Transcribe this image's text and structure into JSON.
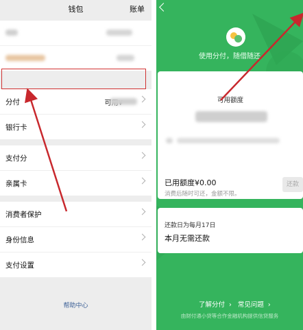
{
  "left": {
    "header": {
      "title": "钱包",
      "bill_label": "账单"
    },
    "pay_row": {
      "label": "分付",
      "available_prefix": "可用¥"
    },
    "menu": [
      {
        "label": "银行卡"
      },
      {
        "label": "支付分"
      },
      {
        "label": "亲属卡"
      },
      {
        "label": "消费者保护"
      },
      {
        "label": "身份信息"
      },
      {
        "label": "支付设置"
      }
    ],
    "help_label": "帮助中心"
  },
  "right": {
    "slogan": "使用分付，随借随还",
    "available_title": "可用额度",
    "used_amount": "已用额度¥0.00",
    "note": "消费后随时可还，金额不限。",
    "repay_button": "还款",
    "repay_day": "还款日为每月17日",
    "status": "本月无需还款",
    "link_learn": "了解分付",
    "link_faq": "常见问题",
    "footer": "由财付通小贷等合作金融机构提供信贷服务"
  },
  "colors": {
    "accent_green": "#35b45d",
    "highlight_red": "#d03030"
  }
}
